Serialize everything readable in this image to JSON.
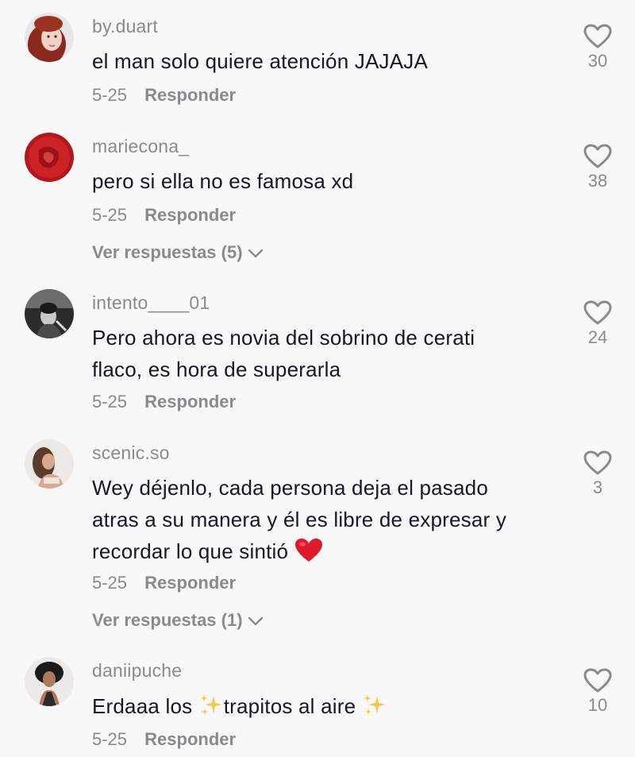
{
  "comments": [
    {
      "username": "by.duart",
      "text": "el man solo quiere atención JAJAJA",
      "date": "5-25",
      "reply_label": "Responder",
      "likes": "30"
    },
    {
      "username": "mariecona_",
      "text": "pero si ella no es famosa xd",
      "date": "5-25",
      "reply_label": "Responder",
      "likes": "38",
      "view_replies": "Ver respuestas (5)"
    },
    {
      "username": "intento____01",
      "text_lines": [
        "Pero ahora es novia del sobrino de cerati",
        "flaco, es hora de superarla"
      ],
      "date": "5-25",
      "reply_label": "Responder",
      "likes": "24"
    },
    {
      "username": "scenic.so",
      "text_lines": [
        "Wey déjenlo, cada persona deja el pasado",
        "atras a su manera y él es libre de expresar y",
        "recordar lo que sintió"
      ],
      "date": "5-25",
      "reply_label": "Responder",
      "likes": "3",
      "view_replies": "Ver respuestas (1)"
    },
    {
      "username": "daniipuche",
      "text_parts": [
        "Erdaaa los ",
        "trapitos al aire "
      ],
      "date": "5-25",
      "reply_label": "Responder",
      "likes": "10"
    }
  ],
  "icons": {
    "like": "heart-outline-icon",
    "expand": "chevron-down-icon",
    "heart_emoji": "red-heart-emoji",
    "sparkles_emoji": "sparkles-emoji"
  },
  "colors": {
    "background": "#f8f8f8",
    "text": "#161823",
    "secondary": "#8a8a8e",
    "heart_emoji": "#e0182b",
    "sparkles": "#f7c64a"
  }
}
